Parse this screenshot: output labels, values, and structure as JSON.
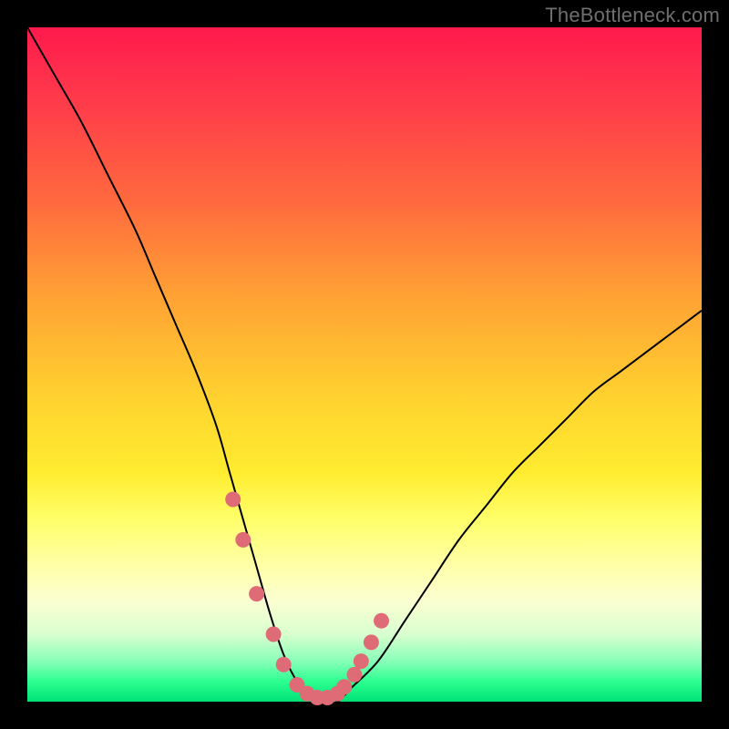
{
  "watermark": "TheBottleneck.com",
  "colors": {
    "background": "#000000",
    "curve": "#000000",
    "marker": "#df6b77",
    "gradient_top": "#ff1a4d",
    "gradient_bottom": "#00e276"
  },
  "chart_data": {
    "type": "line",
    "title": "",
    "xlabel": "",
    "ylabel": "",
    "xlim": [
      0,
      100
    ],
    "ylim": [
      0,
      100
    ],
    "grid": false,
    "legend": false,
    "series": [
      {
        "name": "bottleneck-curve",
        "x": [
          0,
          4,
          8,
          12,
          16,
          19,
          22,
          25,
          28,
          30,
          32,
          34,
          36,
          38,
          40,
          42,
          44,
          46,
          48,
          52,
          56,
          60,
          64,
          68,
          72,
          76,
          80,
          84,
          88,
          92,
          96,
          100
        ],
        "y": [
          100,
          93,
          86,
          78,
          70,
          63,
          56,
          49,
          41,
          34,
          27,
          20,
          13,
          7,
          3,
          1,
          0,
          0,
          2,
          6,
          12,
          18,
          24,
          29,
          34,
          38,
          42,
          46,
          49,
          52,
          55,
          58
        ]
      }
    ],
    "markers": {
      "name": "highlighted-points",
      "x": [
        30.5,
        32,
        34,
        36.5,
        38,
        40,
        41.5,
        43,
        44.5,
        46,
        47,
        48.5,
        49.5,
        51,
        52.5
      ],
      "y": [
        30,
        24,
        16,
        10,
        5.5,
        2.5,
        1.2,
        0.6,
        0.6,
        1.2,
        2.2,
        4.0,
        6.0,
        8.8,
        12.0
      ]
    }
  }
}
